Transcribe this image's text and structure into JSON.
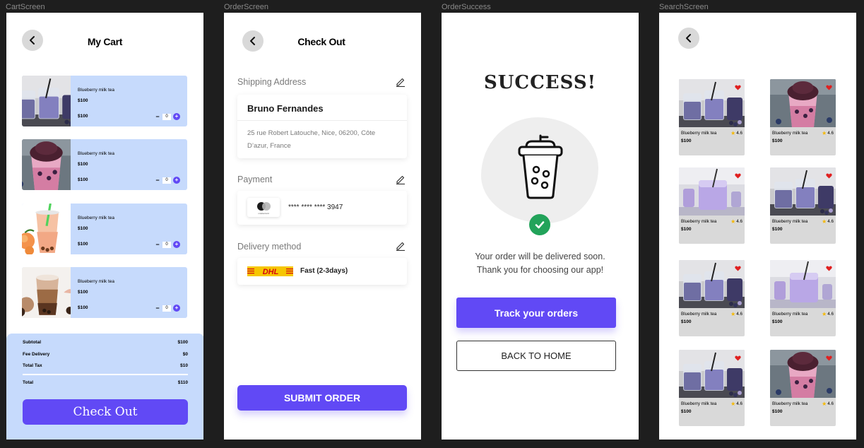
{
  "labels": {
    "cart": "CartScreen",
    "order": "OrderScreen",
    "success": "OrderSuccess",
    "search": "SearchScreen"
  },
  "colors": {
    "accent": "#6149f5",
    "card_bg": "#c6dafc",
    "success_green": "#22a35a",
    "heart_red": "#e02020",
    "star_yellow": "#f5b800"
  },
  "cart": {
    "title": "My Cart",
    "items": [
      {
        "name": "Blueberry milk tea",
        "price": "$100",
        "total": "$100",
        "qty": "0",
        "image": "purple-tea-jars"
      },
      {
        "name": "Blueberry milk tea",
        "price": "$100",
        "total": "$100",
        "qty": "0",
        "image": "pink-blueberry-cup"
      },
      {
        "name": "Blueberry milk tea",
        "price": "$100",
        "total": "$100",
        "qty": "0",
        "image": "peach-bubble-tea"
      },
      {
        "name": "Blueberry milk tea",
        "price": "$100",
        "total": "$100",
        "qty": "0",
        "image": "iced-coffee-boba"
      }
    ],
    "summary": {
      "subtotal_label": "Subtotal",
      "subtotal": "$100",
      "delivery_label": "Fee Delivery",
      "delivery": "$0",
      "tax_label": "Total Tax",
      "tax": "$10",
      "total_label": "Total",
      "total": "$110"
    },
    "checkout_label": "Check Out"
  },
  "order": {
    "title": "Check Out",
    "shipping_label": "Shipping Address",
    "name": "Bruno Fernandes",
    "address": "25 rue Robert Latouche, Nice, 06200, Côte D’azur, France",
    "payment_label": "Payment",
    "card_brand_text": "mastercard",
    "card_number": "**** **** **** 3947",
    "delivery_label": "Delivery method",
    "courier_logo_text": "DHL",
    "delivery_option": "Fast (2-3days)",
    "submit_label": "SUBMIT ORDER"
  },
  "success": {
    "title": "SUCCESS!",
    "line1": "Your order will be delivered soon.",
    "line2": "Thank you for choosing our app!",
    "track_label": "Track your orders",
    "home_label": "BACK TO HOME"
  },
  "search": {
    "products": [
      {
        "name": "Blueberry milk tea",
        "rating": "4.6",
        "price": "$100",
        "image": "purple-tea-jars",
        "favorite": true
      },
      {
        "name": "Blueberry milk tea",
        "rating": "4.6",
        "price": "$100",
        "image": "pink-blueberry-cup",
        "favorite": true
      },
      {
        "name": "Blueberry milk tea",
        "rating": "4.6",
        "price": "$100",
        "image": "lavender-milk-glass",
        "favorite": true
      },
      {
        "name": "Blueberry milk tea",
        "rating": "4.6",
        "price": "$100",
        "image": "purple-tea-jars",
        "favorite": true
      },
      {
        "name": "Blueberry milk tea",
        "rating": "4.6",
        "price": "$100",
        "image": "purple-tea-jars",
        "favorite": true
      },
      {
        "name": "Blueberry milk tea",
        "rating": "4.6",
        "price": "$100",
        "image": "lavender-milk-glass",
        "favorite": true
      },
      {
        "name": "Blueberry milk tea",
        "rating": "4.6",
        "price": "$100",
        "image": "purple-tea-jars",
        "favorite": true
      },
      {
        "name": "Blueberry milk tea",
        "rating": "4.6",
        "price": "$100",
        "image": "pink-blueberry-cup",
        "favorite": true
      }
    ]
  }
}
